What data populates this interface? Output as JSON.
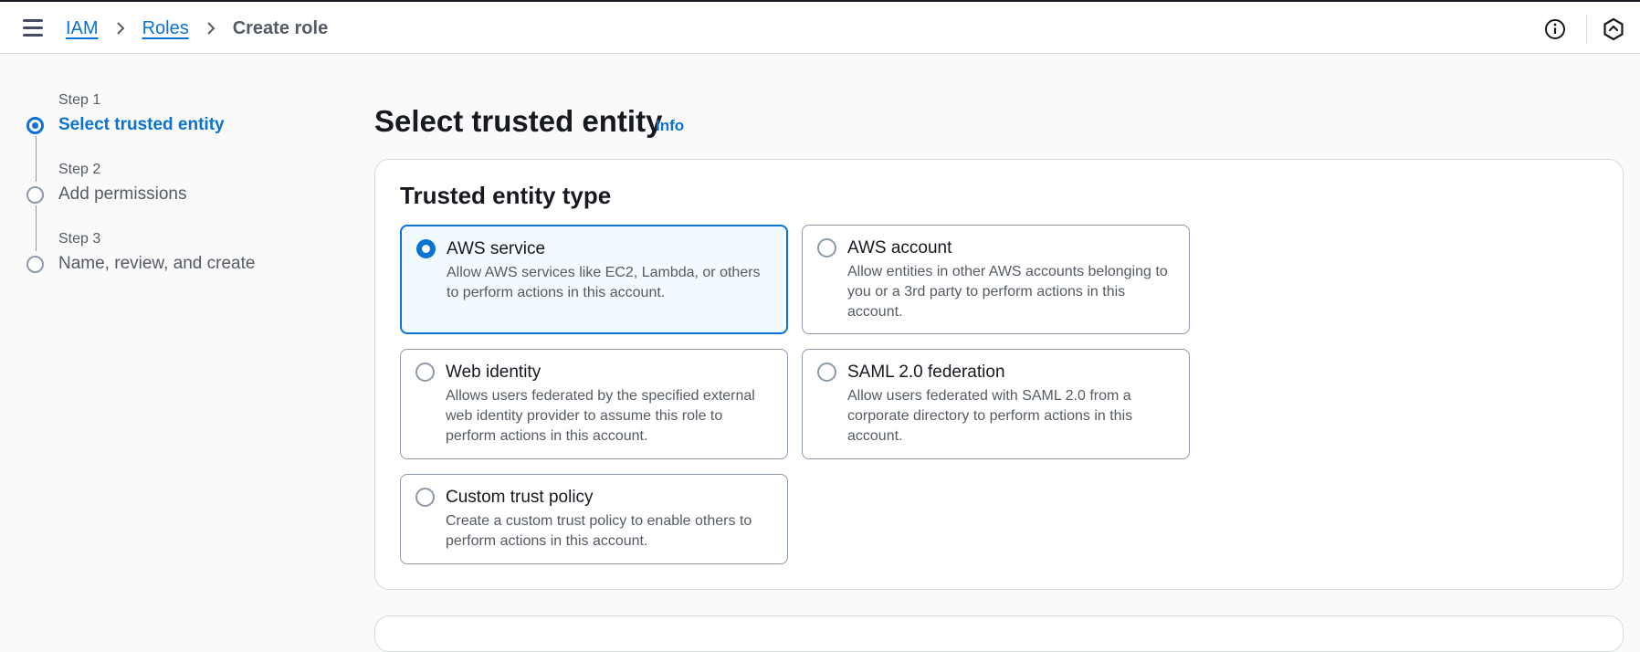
{
  "header": {
    "breadcrumb": {
      "items": [
        "IAM",
        "Roles"
      ],
      "current": "Create role"
    },
    "icons": [
      "menu-icon",
      "chevron-right-icon",
      "info-icon",
      "settings-hexagon-icon"
    ]
  },
  "steps": [
    {
      "number": "Step 1",
      "title": "Select trusted entity",
      "active": true
    },
    {
      "number": "Step 2",
      "title": "Add permissions",
      "active": false
    },
    {
      "number": "Step 3",
      "title": "Name, review, and create",
      "active": false
    }
  ],
  "page": {
    "title": "Select trusted entity",
    "info": "Info"
  },
  "trusted_entity": {
    "title": "Trusted entity type",
    "selected": "AWS service",
    "options": [
      {
        "title": "AWS service",
        "description": "Allow AWS services like EC2, Lambda, or others to perform actions in this account."
      },
      {
        "title": "AWS account",
        "description": "Allow entities in other AWS accounts belonging to you or a 3rd party to perform actions in this account."
      },
      {
        "title": "Web identity",
        "description": "Allows users federated by the specified external web identity provider to assume this role to perform actions in this account."
      },
      {
        "title": "SAML 2.0 federation",
        "description": "Allow users federated with SAML 2.0 from a corporate directory to perform actions in this account."
      },
      {
        "title": "Custom trust policy",
        "description": "Create a custom trust policy to enable others to perform actions in this account."
      }
    ]
  },
  "colors": {
    "accent": "#0972d3",
    "selected_background": "#f1faff",
    "text_primary": "#16191f",
    "text_secondary": "#545b64",
    "border": "#8d99a8"
  }
}
